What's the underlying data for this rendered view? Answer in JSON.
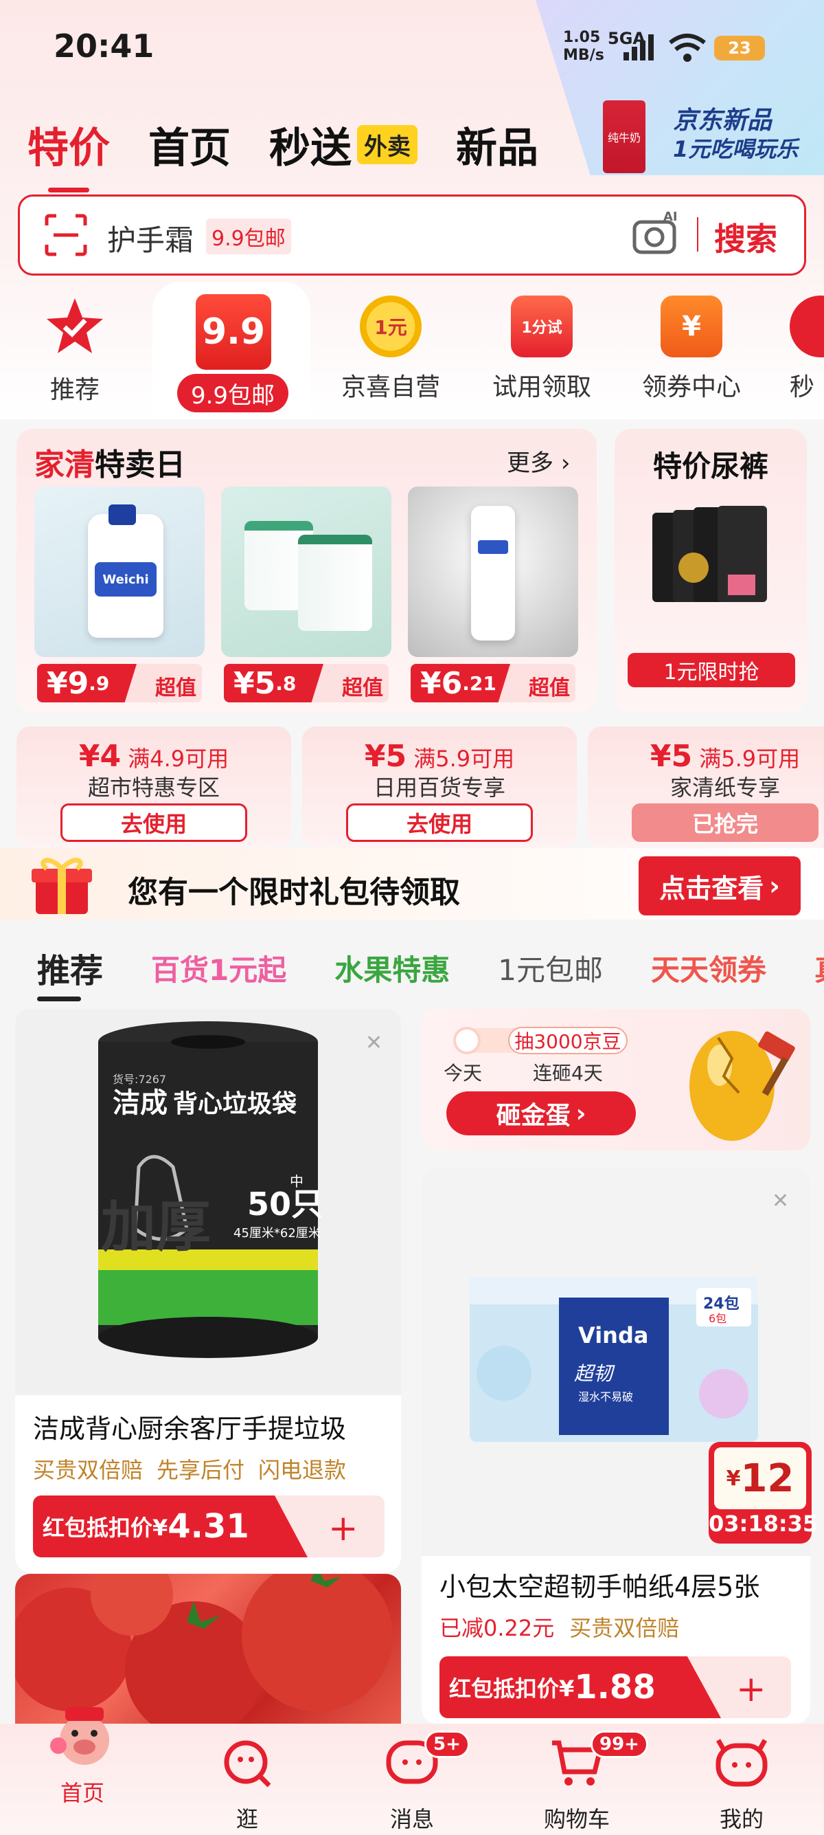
{
  "status": {
    "time": "20:41",
    "speed": "1.05\nMB/s",
    "network": "5GA",
    "battery": "23"
  },
  "promo": {
    "title": "京东新品",
    "subtitle": "1元吃喝玩乐",
    "product_label": "纯牛奶"
  },
  "tabs": [
    {
      "label": "特价",
      "active": true
    },
    {
      "label": "首页"
    },
    {
      "label": "秒送"
    },
    {
      "label": "新品"
    }
  ],
  "waimai_badge": "外卖",
  "search": {
    "query": "护手霜",
    "tag": "9.9包邮",
    "button": "搜索",
    "ai_label": "AI"
  },
  "categories": [
    {
      "label": "推荐",
      "icon": "star-check-icon"
    },
    {
      "label": "9.9包邮",
      "icon_text": "9.9"
    },
    {
      "label": "京喜自营",
      "icon_text": "1元"
    },
    {
      "label": "试用领取",
      "icon_text": "1分试"
    },
    {
      "label": "领券中心",
      "icon_text": "¥"
    },
    {
      "label": "秒"
    }
  ],
  "jiaqing": {
    "title_red": "家清",
    "title_black": "特卖日",
    "more": "更多",
    "products": [
      {
        "price_int": "¥9",
        "price_dec": ".9",
        "tag": "超值",
        "brand": "Weichi"
      },
      {
        "price_int": "¥5",
        "price_dec": ".8",
        "tag": "超值"
      },
      {
        "price_int": "¥6",
        "price_dec": ".21",
        "tag": "超值"
      }
    ]
  },
  "diaper": {
    "title": "特价尿裤",
    "button": "1元限时抢"
  },
  "coupons": [
    {
      "currency": "¥",
      "amount": "4",
      "cond": "满4.9可用",
      "name": "超市特惠专区",
      "action": "去使用"
    },
    {
      "currency": "¥",
      "amount": "5",
      "cond": "满5.9可用",
      "name": "日用百货专享",
      "action": "去使用"
    },
    {
      "currency": "¥",
      "amount": "5",
      "cond": "满5.9可用",
      "name": "家清纸专享",
      "action": "已抢完"
    }
  ],
  "gift": {
    "text": "您有一个限时礼包待领取",
    "button": "点击查看"
  },
  "feed_tabs": [
    {
      "label": "推荐",
      "color": "#222222"
    },
    {
      "label": "百货1元起",
      "color": "#ee5fa0"
    },
    {
      "label": "水果特惠",
      "color": "#3aa640"
    },
    {
      "label": "1元包邮",
      "color": "#555555"
    },
    {
      "label": "天天领券",
      "color": "#f0554d"
    },
    {
      "label": "真",
      "color": "#f0554d"
    }
  ],
  "card1": {
    "title": "洁成背心厨余客厅手提垃圾",
    "tags": [
      "买贵双倍赔",
      "先享后付",
      "闪电退款"
    ],
    "price_label": "红包抵扣价¥",
    "price": "4.31",
    "product_brand": "洁成",
    "product_name": "背心垃圾袋",
    "product_count": "50只",
    "product_size": "45厘米*62厘米",
    "product_size_tag": "中",
    "product_code": "货号:7267",
    "product_stamp": "加厚"
  },
  "egg": {
    "points": "抽3000京豆",
    "today": "今天",
    "streak": "连砸4天",
    "button": "砸金蛋"
  },
  "card3": {
    "title": "小包太空超韧手帕纸4层5张",
    "tags": [
      "已减0.22元",
      "买贵双倍赔"
    ],
    "timer_currency": "¥",
    "timer_price": "12",
    "countdown": "03:18:35",
    "price_label": "红包抵扣价¥",
    "price": "1.88",
    "product_brand": "Vinda",
    "product_name": "超韧",
    "product_count": "24包",
    "product_count2": "6包",
    "product_note": "湿水不易破"
  },
  "nav": [
    {
      "label": "首页",
      "icon": "home-pig-icon"
    },
    {
      "label": "逛",
      "icon": "browse-icon"
    },
    {
      "label": "消息",
      "icon": "message-icon",
      "badge": "5+"
    },
    {
      "label": "购物车",
      "icon": "cart-icon",
      "badge": "99+"
    },
    {
      "label": "我的",
      "icon": "profile-icon"
    }
  ],
  "colors": {
    "brand_red": "#e5202e",
    "tag_gold": "#c0832a"
  }
}
